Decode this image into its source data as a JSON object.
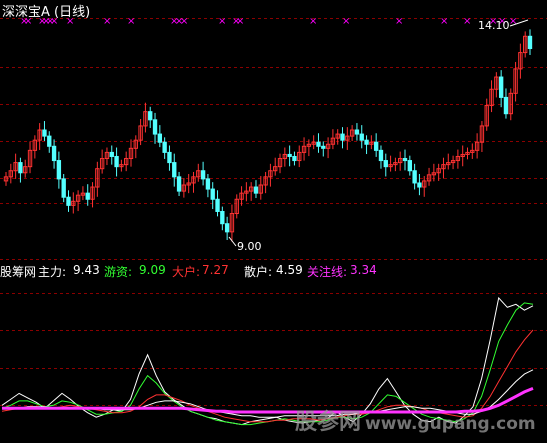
{
  "header": {
    "stock_title": "深深宝A (日线)"
  },
  "annotations": {
    "high_label": "14.10",
    "low_label": "9.00"
  },
  "indicator": {
    "name": "股筹网",
    "items": [
      {
        "label": "主力:",
        "value": "9.43",
        "color": "#ffffff"
      },
      {
        "label": "游资:",
        "value": "9.09",
        "color": "#32ff32"
      },
      {
        "label": "大户:",
        "value": "7.27",
        "color": "#ff3232"
      },
      {
        "label": "散户:",
        "value": "4.59",
        "color": "#ffffff"
      },
      {
        "label": "关注线:",
        "value": "3.34",
        "color": "#ff33ff"
      }
    ]
  },
  "watermark": {
    "site": "股参网",
    "url": "www.gupang.com"
  },
  "colors": {
    "up": "#ff3232",
    "down": "#54ffff",
    "grid": "#8b0000",
    "marker": "#ff00ff",
    "attention": "#ff33ff",
    "green": "#32ff32",
    "white": "#ffffff",
    "red": "#ff3232"
  },
  "chart_data": [
    {
      "type": "candlestick",
      "title": "深深宝A (日线)",
      "high_marker": 14.1,
      "low_marker": 9.0,
      "closes": [
        10.45,
        10.6,
        10.8,
        10.55,
        10.7,
        11.1,
        11.35,
        11.6,
        11.45,
        11.2,
        10.85,
        10.4,
        9.95,
        9.75,
        9.85,
        10.0,
        10.05,
        9.9,
        10.2,
        10.65,
        10.9,
        11.05,
        10.95,
        10.7,
        10.75,
        10.9,
        11.15,
        11.35,
        11.7,
        12.05,
        11.85,
        11.5,
        11.3,
        11.05,
        10.8,
        10.45,
        10.1,
        10.25,
        10.3,
        10.45,
        10.6,
        10.4,
        10.15,
        9.9,
        9.6,
        9.3,
        9.1,
        9.55,
        9.9,
        10.05,
        10.1,
        10.2,
        10.05,
        10.25,
        10.45,
        10.6,
        10.7,
        10.9,
        11.0,
        10.95,
        10.85,
        11.05,
        11.2,
        11.25,
        11.3,
        11.2,
        11.15,
        11.25,
        11.4,
        11.5,
        11.35,
        11.45,
        11.6,
        11.5,
        11.35,
        11.25,
        11.3,
        11.1,
        10.85,
        10.7,
        10.75,
        10.8,
        10.9,
        10.85,
        10.6,
        10.3,
        10.2,
        10.35,
        10.5,
        10.55,
        10.65,
        10.75,
        10.8,
        10.85,
        10.95,
        11.0,
        11.05,
        11.1,
        11.3,
        11.7,
        12.2,
        12.6,
        12.9,
        12.4,
        12.0,
        12.5,
        13.1,
        13.5,
        13.9,
        13.6
      ],
      "ylim": [
        8.9,
        14.3
      ]
    },
    {
      "type": "line",
      "title": "股筹网",
      "series": [
        {
          "name": "主力",
          "values": [
            2.2,
            2.6,
            3.0,
            2.7,
            2.4,
            2.0,
            2.5,
            3.0,
            2.6,
            2.1,
            1.7,
            1.4,
            1.6,
            1.9,
            1.8,
            2.6,
            4.3,
            5.6,
            4.2,
            3.1,
            2.6,
            2.2,
            1.8,
            1.6,
            1.4,
            1.3,
            1.1,
            1.0,
            0.9,
            1.1,
            1.2,
            1.3,
            1.4,
            1.2,
            1.1,
            1.0,
            1.1,
            1.2,
            1.3,
            1.8,
            1.4,
            1.1,
            1.6,
            2.3,
            3.3,
            4.0,
            3.1,
            2.2,
            1.6,
            1.2,
            1.1,
            1.4,
            1.1,
            1.0,
            1.5,
            2.1,
            4.0,
            6.6,
            9.43,
            8.8,
            9.0,
            8.6,
            8.9
          ]
        },
        {
          "name": "游资",
          "values": [
            2.0,
            2.2,
            2.5,
            2.5,
            2.3,
            2.1,
            2.2,
            2.5,
            2.4,
            2.2,
            1.9,
            1.6,
            1.6,
            1.7,
            1.8,
            2.2,
            3.3,
            4.2,
            3.7,
            3.0,
            2.5,
            2.1,
            1.8,
            1.6,
            1.4,
            1.2,
            1.1,
            1.0,
            0.9,
            0.9,
            1.0,
            1.1,
            1.2,
            1.3,
            1.2,
            1.1,
            1.1,
            1.1,
            1.2,
            1.4,
            1.4,
            1.3,
            1.4,
            1.7,
            2.3,
            2.9,
            2.8,
            2.4,
            2.0,
            1.6,
            1.4,
            1.3,
            1.2,
            1.1,
            1.3,
            1.7,
            2.8,
            4.6,
            6.5,
            7.6,
            8.6,
            9.09,
            9.0
          ]
        },
        {
          "name": "大户",
          "values": [
            1.8,
            1.9,
            2.0,
            2.1,
            2.1,
            2.0,
            2.0,
            2.1,
            2.2,
            2.1,
            2.0,
            1.9,
            1.8,
            1.7,
            1.7,
            1.8,
            2.1,
            2.6,
            2.9,
            2.9,
            2.7,
            2.5,
            2.2,
            2.0,
            1.8,
            1.6,
            1.4,
            1.3,
            1.2,
            1.1,
            1.1,
            1.1,
            1.2,
            1.2,
            1.3,
            1.3,
            1.3,
            1.2,
            1.3,
            1.4,
            1.5,
            1.6,
            1.6,
            1.7,
            1.9,
            2.1,
            2.2,
            2.2,
            2.1,
            2.0,
            1.8,
            1.7,
            1.6,
            1.5,
            1.4,
            1.5,
            2.0,
            2.8,
            3.8,
            4.8,
            5.8,
            6.6,
            7.27
          ]
        },
        {
          "name": "散户",
          "values": [
            2.0,
            2.0,
            2.0,
            2.1,
            2.1,
            2.1,
            2.0,
            2.0,
            2.0,
            2.0,
            2.0,
            2.0,
            1.9,
            1.9,
            1.9,
            1.9,
            2.0,
            2.2,
            2.4,
            2.5,
            2.5,
            2.4,
            2.3,
            2.1,
            1.9,
            1.8,
            1.7,
            1.6,
            1.5,
            1.5,
            1.4,
            1.4,
            1.4,
            1.5,
            1.5,
            1.5,
            1.5,
            1.5,
            1.5,
            1.5,
            1.6,
            1.6,
            1.7,
            1.7,
            1.8,
            1.9,
            2.0,
            2.1,
            2.1,
            2.0,
            2.0,
            1.9,
            1.8,
            1.7,
            1.6,
            1.6,
            1.8,
            2.1,
            2.6,
            3.2,
            3.8,
            4.3,
            4.59
          ]
        },
        {
          "name": "关注线",
          "values": [
            2.0,
            2.0,
            2.0,
            2.0,
            2.0,
            2.0,
            2.0,
            2.0,
            2.0,
            2.0,
            2.0,
            2.0,
            2.0,
            2.0,
            2.0,
            2.0,
            2.0,
            2.0,
            2.0,
            2.0,
            2.0,
            2.0,
            1.95,
            1.9,
            1.85,
            1.8,
            1.8,
            1.75,
            1.75,
            1.75,
            1.75,
            1.75,
            1.75,
            1.75,
            1.75,
            1.75,
            1.75,
            1.75,
            1.75,
            1.75,
            1.75,
            1.75,
            1.75,
            1.75,
            1.75,
            1.75,
            1.75,
            1.75,
            1.75,
            1.75,
            1.75,
            1.75,
            1.75,
            1.75,
            1.8,
            1.8,
            1.85,
            2.0,
            2.2,
            2.5,
            2.8,
            3.1,
            3.34
          ]
        }
      ],
      "ylim": [
        0,
        10.5
      ]
    }
  ]
}
